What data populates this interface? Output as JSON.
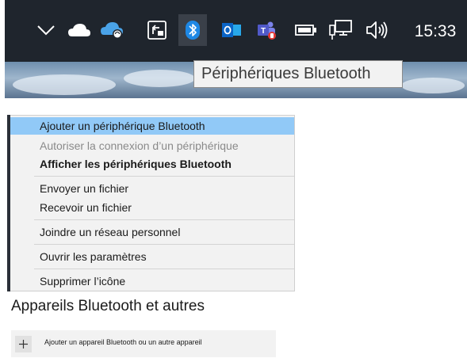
{
  "taskbar": {
    "icons": [
      {
        "name": "chevron-up-icon"
      },
      {
        "name": "onedrive-cloud-icon"
      },
      {
        "name": "onedrive-sync-icon"
      },
      {
        "name": "app-tray-icon"
      },
      {
        "name": "bluetooth-icon"
      },
      {
        "name": "outlook-icon"
      },
      {
        "name": "teams-icon"
      },
      {
        "name": "battery-icon"
      },
      {
        "name": "network-icon"
      },
      {
        "name": "volume-icon"
      }
    ],
    "clock": "15:33",
    "accent": "#1e88e5"
  },
  "tooltip": {
    "text": "Périphériques Bluetooth"
  },
  "menu": {
    "items": [
      {
        "label": "Ajouter un périphérique Bluetooth",
        "state": "highlighted"
      },
      {
        "label": "Autoriser la connexion d’un périphérique",
        "state": "disabled"
      },
      {
        "label": "Afficher les périphériques Bluetooth",
        "state": "default-bold"
      },
      {
        "label": "Envoyer un fichier",
        "state": "normal"
      },
      {
        "label": "Recevoir un fichier",
        "state": "normal"
      },
      {
        "label": "Joindre un réseau personnel",
        "state": "normal"
      },
      {
        "label": "Ouvrir les paramètres",
        "state": "normal"
      },
      {
        "label": "Supprimer l’icône",
        "state": "normal"
      }
    ],
    "highlight_color": "#91c9f7"
  },
  "settings": {
    "section_title": "Appareils Bluetooth et autres",
    "add_device_label": "Ajouter un appareil Bluetooth ou un autre appareil"
  }
}
